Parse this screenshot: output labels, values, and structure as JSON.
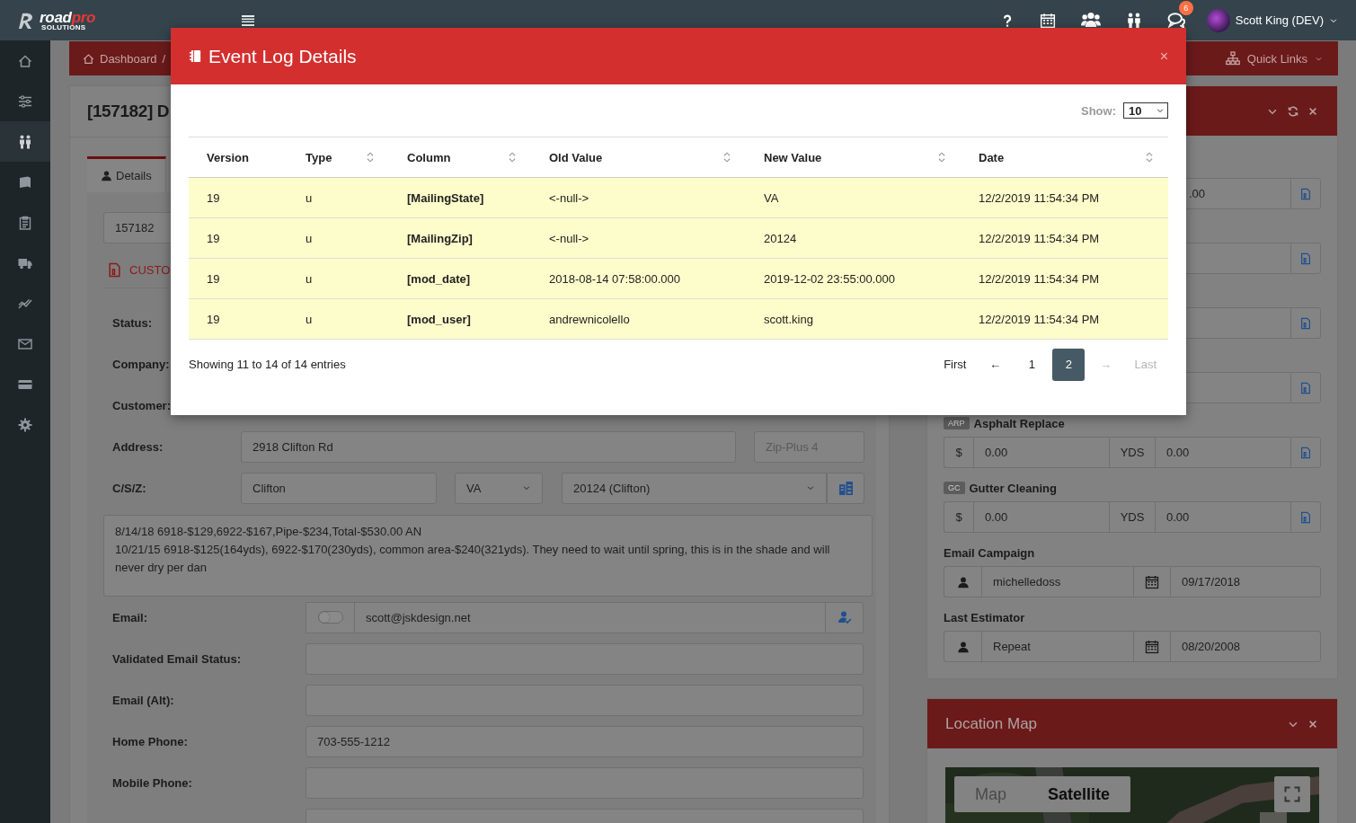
{
  "header": {
    "logo": {
      "word": "road",
      "accent": "pro",
      "tagline": "SOLUTIONS"
    },
    "notification_count": "6",
    "user_name": "Scott King (DEV)"
  },
  "sidebar": {
    "items": [
      {
        "selected": false
      },
      {
        "selected": false
      },
      {
        "selected": true
      },
      {
        "selected": false
      },
      {
        "selected": false
      },
      {
        "selected": false
      },
      {
        "selected": false
      },
      {
        "selected": false
      },
      {
        "selected": false
      },
      {
        "selected": false
      }
    ]
  },
  "breadcrumb": {
    "items": [
      "Dashboard"
    ],
    "separator": "/",
    "quick_links": "Quick Links"
  },
  "record": {
    "title": "[157182] D",
    "tabs": [
      {
        "label": "Details",
        "selected": true
      }
    ],
    "record_id": "157182",
    "section_link": "CUSTO",
    "rows": [
      {
        "kind": "label",
        "label": "Status:"
      },
      {
        "kind": "label",
        "label": "Company:"
      },
      {
        "kind": "label",
        "label": "Customer:"
      },
      {
        "kind": "address",
        "label": "Address:",
        "street": "2918 Clifton Rd",
        "zip_placeholder": "Zip-Plus 4"
      },
      {
        "kind": "csz",
        "label": "C/S/Z:",
        "city": "Clifton",
        "state": "VA",
        "zip": "20124 (Clifton)"
      }
    ],
    "notes": "8/14/18 6918-$129,6922-$167,Pipe-$234,Total-$530.00 AN\n10/21/15 6918-$125(164yds), 6922-$170(230yds), common area-$240(321yds). They need to wait until spring, this is in the shade and will never dry per dan",
    "contact_rows": [
      {
        "kind": "email",
        "label": "Email:",
        "value": "scott@jskdesign.net",
        "toggle_on": false
      },
      {
        "kind": "text",
        "label": "Validated Email Status:"
      },
      {
        "kind": "text",
        "label": "Email (Alt):"
      },
      {
        "kind": "text",
        "label": "Home Phone:",
        "value": "703-555-1212"
      },
      {
        "kind": "text",
        "label": "Mobile Phone:"
      },
      {
        "kind": "text"
      }
    ]
  },
  "estimate_card": {
    "groups": [
      {
        "kind": "service",
        "quantity": ".00"
      },
      {
        "kind": "service"
      },
      {
        "kind": "service"
      },
      {
        "kind": "service"
      },
      {
        "kind": "service",
        "code": "ARP",
        "name": "Asphalt Replace",
        "currency": "$",
        "price": "0.00",
        "unit": "YDS",
        "quantity": "0.00"
      },
      {
        "kind": "service",
        "code": "GC",
        "name": "Gutter Cleaning",
        "currency": "$",
        "price": "0.00",
        "unit": "YDS",
        "quantity": "0.00"
      },
      {
        "kind": "user-date",
        "label": "Email Campaign",
        "user": "michelledoss",
        "date": "09/17/2018"
      },
      {
        "kind": "user-date",
        "label": "Last Estimator",
        "user": "Repeat",
        "date": "08/20/2008"
      }
    ]
  },
  "location_map": {
    "title": "Location Map",
    "map_types": [
      {
        "label": "Map",
        "selected": false
      },
      {
        "label": "Satellite",
        "selected": true
      }
    ]
  },
  "modal": {
    "title": "Event Log Details",
    "close": "×",
    "show_label": "Show:",
    "page_size": "10",
    "table": {
      "columns": [
        {
          "label": "Version",
          "sortable": false,
          "bold_values": false
        },
        {
          "label": "Type",
          "sortable": true,
          "bold_values": false
        },
        {
          "label": "Column",
          "sortable": true,
          "bold_values": true
        },
        {
          "label": "Old Value",
          "sortable": true,
          "bold_values": false
        },
        {
          "label": "New Value",
          "sortable": true,
          "bold_values": false
        },
        {
          "label": "Date",
          "sortable": true,
          "bold_values": false
        }
      ],
      "rows": [
        [
          "19",
          "u",
          "[MailingState]",
          "<-null->",
          "VA",
          "12/2/2019 11:54:34 PM"
        ],
        [
          "19",
          "u",
          "[MailingZip]",
          "<-null->",
          "20124",
          "12/2/2019 11:54:34 PM"
        ],
        [
          "19",
          "u",
          "[mod_date]",
          "2018-08-14 07:58:00.000",
          "2019-12-02 23:55:00.000",
          "12/2/2019 11:54:34 PM"
        ],
        [
          "19",
          "u",
          "[mod_user]",
          "andrewnicolello",
          "scott.king",
          "12/2/2019 11:54:34 PM"
        ]
      ]
    },
    "summary": "Showing 11 to 14 of 14 entries",
    "pagination": [
      {
        "label": "First",
        "selected": false,
        "disabled": false
      },
      {
        "label": "←",
        "selected": false,
        "disabled": false
      },
      {
        "label": "1",
        "selected": false,
        "disabled": false
      },
      {
        "label": "2",
        "selected": true,
        "disabled": false
      },
      {
        "label": "→",
        "selected": false,
        "disabled": true
      },
      {
        "label": "Last",
        "selected": false,
        "disabled": true
      }
    ]
  }
}
